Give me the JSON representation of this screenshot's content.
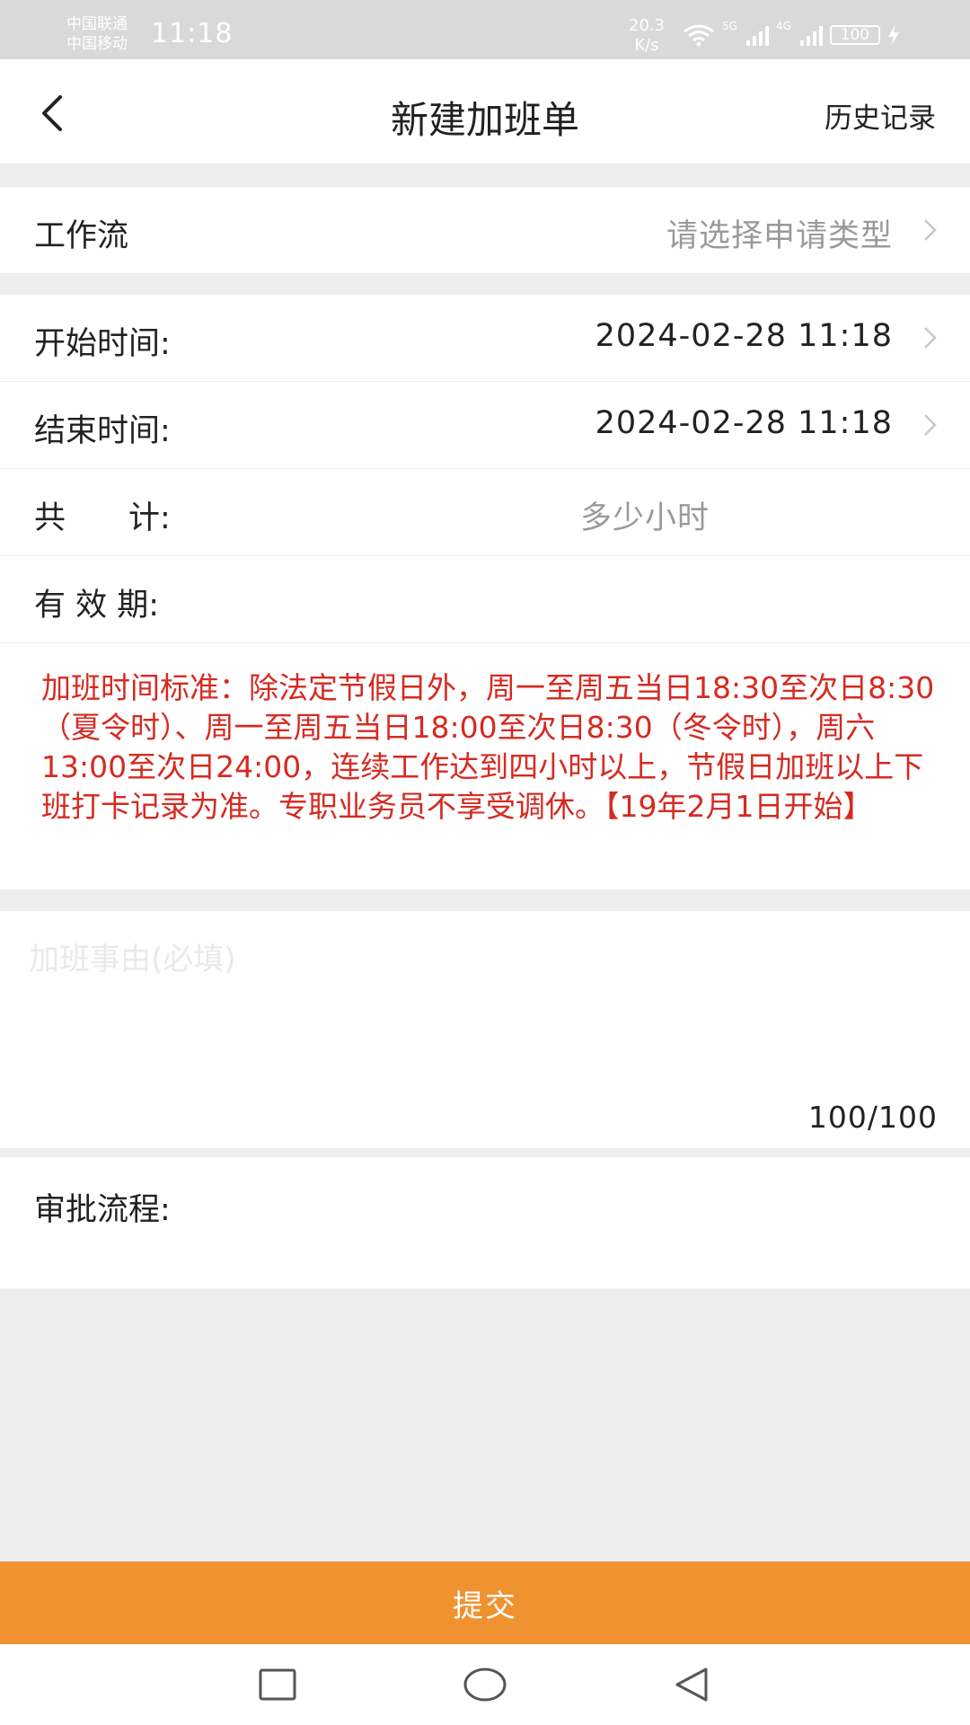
{
  "status_bar": {
    "carrier_1": "中国联通",
    "carrier_2": "中国移动",
    "time": "11:18",
    "speed_value": "20.3",
    "speed_unit": "K/s",
    "net_label_1": "5G",
    "net_label_2": "4G",
    "battery": "100"
  },
  "nav": {
    "title": "新建加班单",
    "history": "历史记录"
  },
  "form": {
    "workflow_label": "工作流",
    "workflow_placeholder": "请选择申请类型",
    "start_label": "开始时间:",
    "start_value": "2024-02-28 11:18",
    "end_label": "结束时间:",
    "end_value": "2024-02-28 11:18",
    "total_label": "共　　计:",
    "total_placeholder": "多少小时",
    "validity_label": "有 效 期:",
    "notice": "加班时间标准：除法定节假日外，周一至周五当日18:30至次日8:30（夏令时）、周一至周五当日18:00至次日8:30（冬令时），周六13:00至次日24:00，连续工作达到四小时以上，节假日加班以上下班打卡记录为准。专职业务员不享受调休。【19年2月1日开始】",
    "reason_placeholder": "加班事由(必填)",
    "counter": "100/100",
    "approval_label": "审批流程:"
  },
  "submit": "提交",
  "colors": {
    "accent": "#f0922f",
    "notice": "#d62a21"
  }
}
